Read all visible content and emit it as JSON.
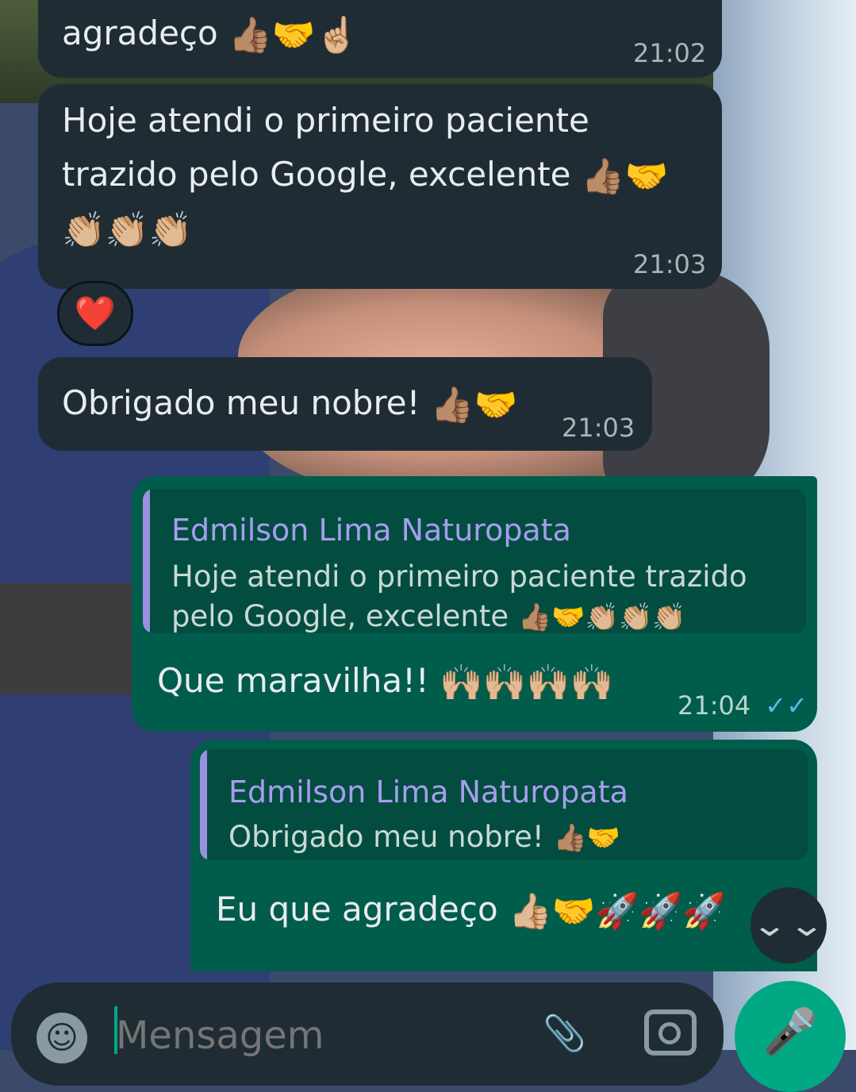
{
  "messages": [
    {
      "text": "agradeço",
      "emoji": "👍🏽🤝☝🏼",
      "time": "21:02"
    },
    {
      "text_line1": "Hoje atendi o primeiro paciente",
      "text_line2": "trazido pelo Google, excelente",
      "emoji_line2": "👍🏽🤝",
      "emoji_line3": "👏🏼👏🏼👏🏼",
      "time": "21:03",
      "reaction": "❤️"
    },
    {
      "text": "Obrigado meu nobre!",
      "emoji": "👍🏽🤝",
      "time": "21:03"
    },
    {
      "quote_author": "Edmilson Lima Naturopata",
      "quote_line1": "Hoje atendi o primeiro paciente trazido",
      "quote_line2": "pelo Google, excelente",
      "quote_emoji": "👍🏽🤝👏🏼👏🏼👏🏼",
      "text": "Que maravilha!!",
      "emoji": "🙌🏼🙌🏼🙌🏼🙌🏼",
      "time": "21:04",
      "ticks": "✓✓"
    },
    {
      "quote_author": "Edmilson Lima Naturopata",
      "quote_text": "Obrigado meu nobre!",
      "quote_emoji": "👍🏽🤝",
      "text": "Eu que agradeço",
      "emoji": "👍🏼🤝🚀🚀🚀"
    }
  ],
  "composer": {
    "placeholder": "Mensagem",
    "emoji_icon": "☺",
    "attach_icon": "📎",
    "mic_icon": "🎤"
  },
  "scroll_icon": "⌄⌄",
  "colors": {
    "incoming": "#1f2c34",
    "outgoing": "#005c4b",
    "accent": "#00a884",
    "quote_author": "#a79df0"
  }
}
